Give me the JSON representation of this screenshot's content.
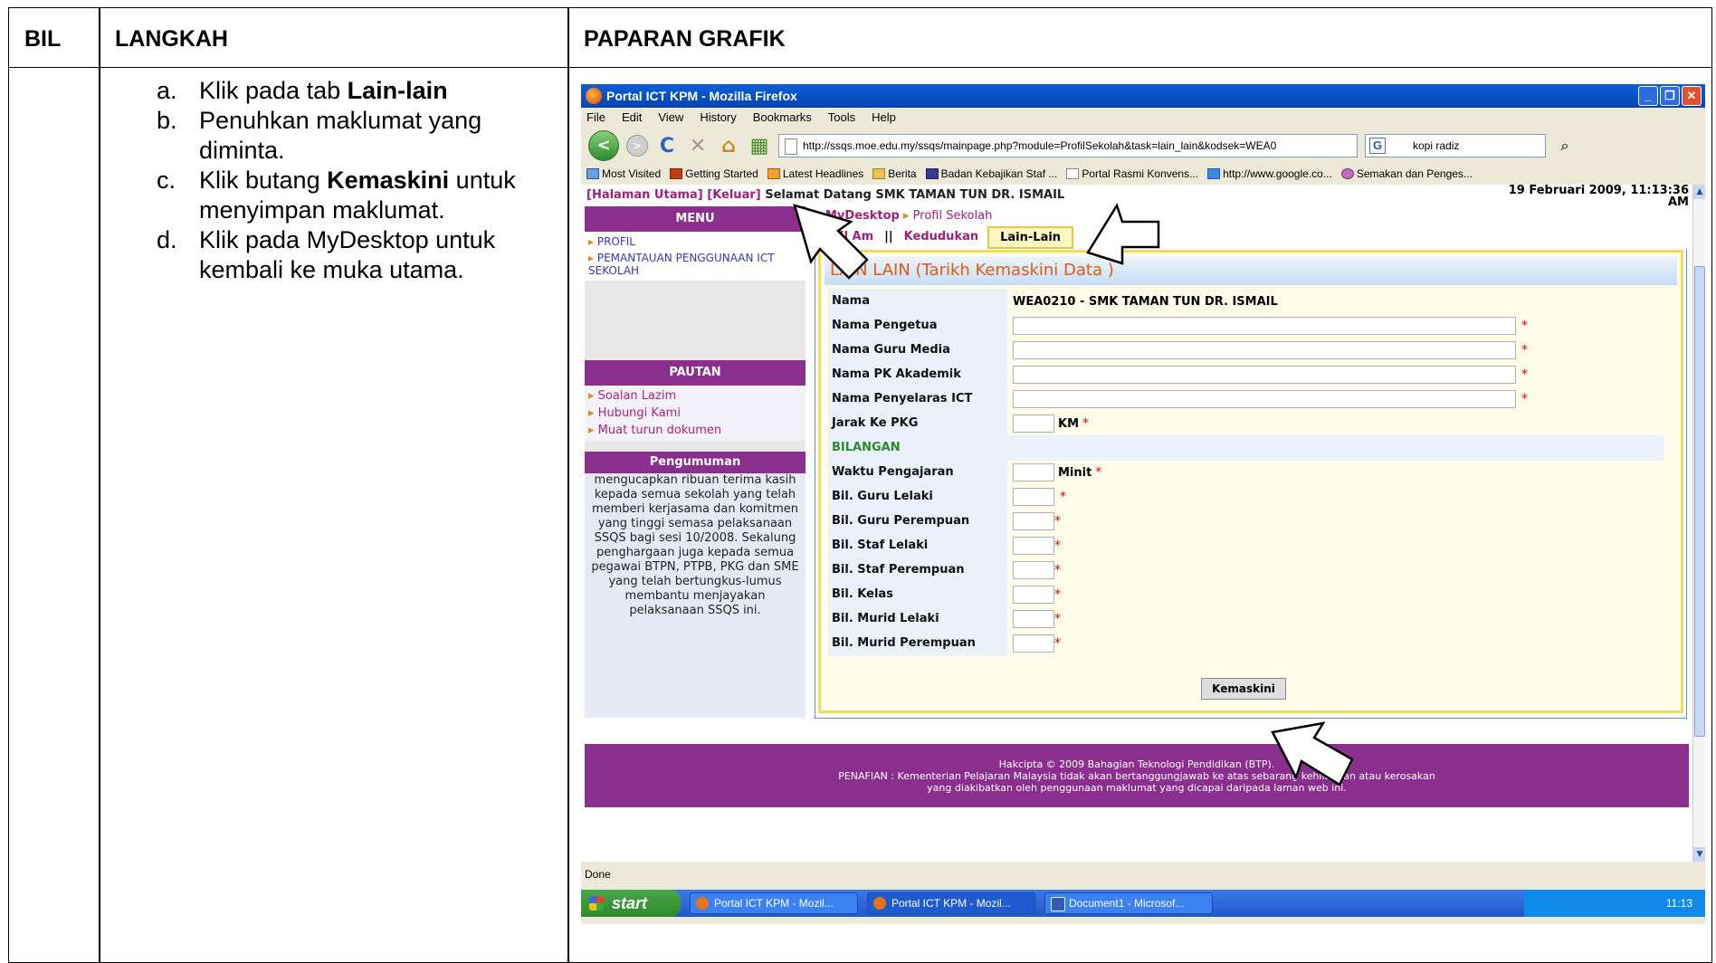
{
  "doc": {
    "col_bil": "BIL",
    "col_langkah": "LANGKAH",
    "col_paparan": "PAPARAN GRAFIK",
    "steps": [
      {
        "letter": "a.",
        "pre": "Klik pada tab ",
        "bold": "Lain-lain",
        "post": ""
      },
      {
        "letter": "b.",
        "pre": "Penuhkan maklumat yang diminta.",
        "bold": "",
        "post": ""
      },
      {
        "letter": "c.",
        "pre": "Klik butang ",
        "bold": "Kemaskini",
        "post": " untuk menyimpan maklumat."
      },
      {
        "letter": "d.",
        "pre": "Klik pada MyDesktop untuk kembali ke muka utama.",
        "bold": "",
        "post": ""
      }
    ]
  },
  "browser": {
    "title": "Portal ICT KPM - Mozilla Firefox",
    "menu": [
      "File",
      "Edit",
      "View",
      "History",
      "Bookmarks",
      "Tools",
      "Help"
    ],
    "url": "http://ssqs.moe.edu.my/ssqs/mainpage.php?module=ProfilSekolah&task=lain_lain&kodsek=WEA0",
    "search_value": "kopi radiz",
    "bookmarks": [
      "Most Visited",
      "Getting Started",
      "Latest Headlines",
      "Berita",
      "Badan Kebajikan Staf ...",
      "Portal Rasmi Konvens...",
      "http://www.google.co...",
      "Semakan dan Penges..."
    ],
    "status": "Done"
  },
  "page": {
    "top_links": "[Halaman Utama] [Keluar]",
    "welcome": "Selamat Datang SMK TAMAN TUN DR. ISMAIL",
    "date_line1": "19 Februari 2009, 11:13:36",
    "date_line2": "AM",
    "menu_head": "MENU",
    "menu_items": [
      "PROFIL",
      "PEMANTAUAN PENGGUNAAN ICT SEKOLAH"
    ],
    "pautan_head": "PAUTAN",
    "pautan_links": [
      "Soalan Lazim",
      "Hubungi Kami",
      "Muat turun dokumen"
    ],
    "pengumuman_head": "Pengumuman",
    "pengumuman_text": "mengucapkan ribuan terima kasih kepada semua sekolah yang telah memberi kerjasama dan komitmen yang tinggi semasa pelaksanaan SSQS bagi sesi 10/2008. Sekalung penghargaan juga kepada semua pegawai BTPN, PTPB, PKG dan SME yang telah bertungkus-lumus membantu menjayakan pelaksanaan SSQS ini.",
    "crumb_home": "MyDesktop",
    "crumb_current": "Profil Sekolah",
    "tabs": [
      "ofil Am",
      "||",
      "Kedudukan",
      "Lain-Lain"
    ],
    "form_title": "LAIN LAIN (Tarikh Kemaskini Data )",
    "nama_label": "Nama",
    "nama_value": "WEA0210 - SMK TAMAN TUN DR. ISMAIL",
    "fields_text": [
      "Nama Pengetua",
      "Nama Guru Media",
      "Nama PK Akademik",
      "Nama Penyelaras ICT"
    ],
    "jarak_label": "Jarak Ke PKG",
    "jarak_unit": "KM",
    "bilangan": "BILANGAN",
    "waktu_label": "Waktu Pengajaran",
    "waktu_unit": "Minit",
    "count_fields": [
      "Bil. Guru Lelaki",
      "Bil. Guru Perempuan",
      "Bil. Staf Lelaki",
      "Bil. Staf Perempuan",
      "Bil. Kelas",
      "Bil. Murid Lelaki",
      "Bil. Murid Perempuan"
    ],
    "submit": "Kemaskini",
    "footer1": "Hakcipta © 2009 Bahagian Teknologi Pendidikan (BTP).",
    "footer2": "PENAFIAN : Kementerian Pelajaran Malaysia tidak akan bertanggungjawab ke atas sebarang kehilangan atau kerosakan",
    "footer3": "yang diakibatkan oleh penggunaan maklumat yang dicapai daripada laman web ini."
  },
  "taskbar": {
    "start": "start",
    "buttons": [
      "Portal ICT KPM - Mozil...",
      "Portal ICT KPM - Mozil...",
      "Document1 - Microsof..."
    ],
    "clock": "11:13"
  }
}
